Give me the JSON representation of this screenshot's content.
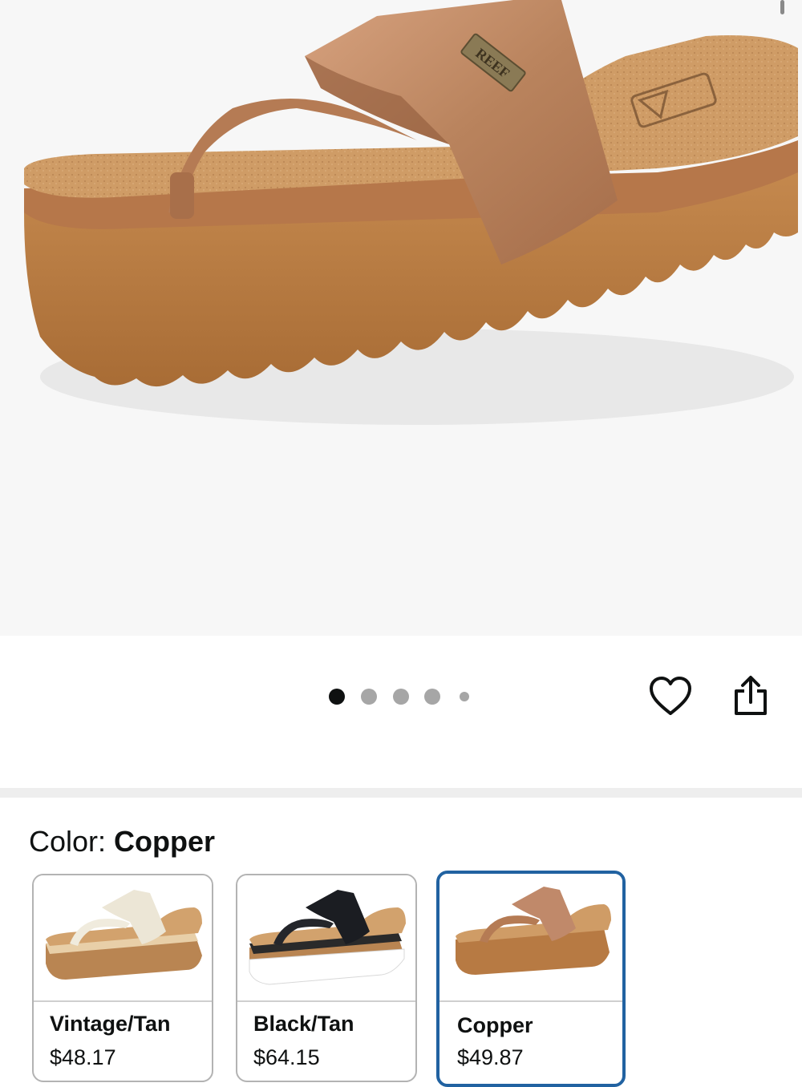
{
  "product": {
    "image_alt": "Copper platform thong sandal",
    "brand_mark": "REEF"
  },
  "gallery": {
    "dot_count": 5,
    "active_index": 0
  },
  "actions": {
    "wishlist_icon": "heart-outline-icon",
    "share_icon": "share-icon"
  },
  "color": {
    "label": "Color:",
    "value": "Copper"
  },
  "swatches": [
    {
      "name": "Vintage/Tan",
      "price": "$48.17",
      "strap_color": "#ece6d6",
      "selected": false
    },
    {
      "name": "Black/Tan",
      "price": "$64.15",
      "strap_color": "#1b1d22",
      "selected": false
    },
    {
      "name": "Copper",
      "price": "$49.87",
      "strap_color": "#c0896a",
      "selected": true
    }
  ],
  "colors": {
    "selected_border": "#2162a1",
    "cork": "#cd9a63",
    "sole": "#b77a43",
    "strap": "#b8845f"
  }
}
